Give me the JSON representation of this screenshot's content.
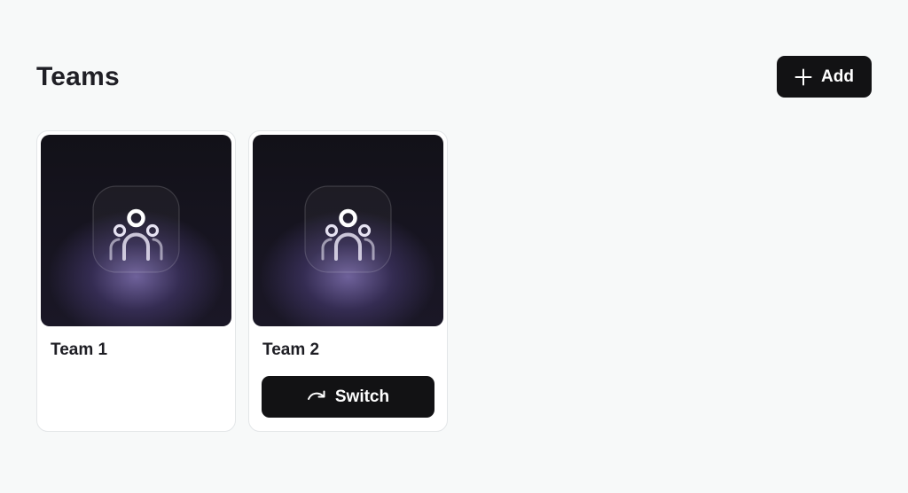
{
  "page": {
    "title": "Teams"
  },
  "toolbar": {
    "add_label": "Add",
    "add_icon": "plus-icon"
  },
  "teams": [
    {
      "name": "Team 1",
      "icon": "team-icon",
      "current": true
    },
    {
      "name": "Team 2",
      "icon": "team-icon",
      "current": false,
      "switch_label": "Switch",
      "switch_icon": "redo-arrow-icon"
    }
  ],
  "colors": {
    "background": "#f7f9f9",
    "button": "#121214",
    "button_text": "#ffffff",
    "card": "#ffffff",
    "card_border": "#e3e6e8",
    "thumbnail_glow": "#7e6fb0"
  }
}
